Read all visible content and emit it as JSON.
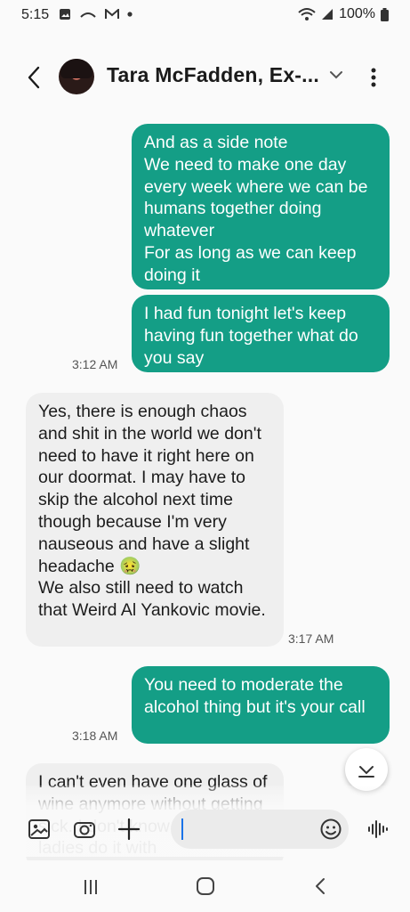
{
  "status_bar": {
    "time": "5:15",
    "battery": "100%",
    "left_icons": [
      "image-icon",
      "voicemail-icon",
      "gmail-icon",
      "dot-icon"
    ],
    "right_icons": [
      "wifi-icon",
      "signal-icon",
      "battery-icon"
    ]
  },
  "header": {
    "contact_name": "Tara McFadden, Ex-...",
    "back_icon": "back-arrow-icon",
    "dropdown_icon": "chevron-down-icon",
    "more_icon": "more-vert-icon"
  },
  "messages": [
    {
      "type": "sent",
      "text": "And as a side note\nWe need to make one day every week where we can be humans together doing whatever\nFor as long as we can keep doing it"
    },
    {
      "type": "sent",
      "text": "I had fun tonight let's keep having fun together what do you say",
      "time": "3:12 AM"
    },
    {
      "type": "received",
      "text": "Yes, there is enough chaos and shit in the world we don't need to have it right here on our doormat. I may have to skip the alcohol next time though because I'm very nauseous and have a slight headache 🤢\nWe also still need to watch that Weird Al Yankovic movie.",
      "time": "3:17 AM"
    },
    {
      "type": "sent",
      "text": "You need to moderate the alcohol thing but it's your call",
      "time": "3:18 AM"
    },
    {
      "type": "received",
      "text": "I can't even have one glass of wine anymore without getting sick. I don't know how old ladies do it with"
    }
  ],
  "composer": {
    "placeholder": "",
    "icons": [
      "gallery-icon",
      "camera-icon",
      "add-icon",
      "emoji-icon",
      "voice-icon"
    ]
  },
  "scroll_down_icon": "scroll-down-icon",
  "nav": {
    "icons": [
      "recents-icon",
      "home-icon",
      "back-icon"
    ]
  },
  "colors": {
    "sent_bubble": "#149e86",
    "received_bubble": "#efefef",
    "background": "#fafafa"
  }
}
